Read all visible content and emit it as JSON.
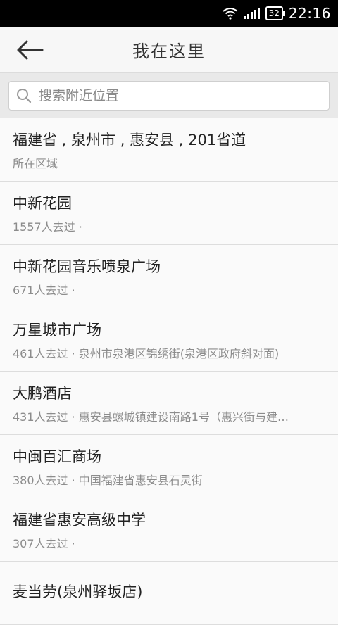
{
  "status_bar": {
    "battery": "32",
    "time": "22:16"
  },
  "header": {
    "title": "我在这里",
    "back_icon": "arrow-left-icon"
  },
  "search": {
    "placeholder": "搜索附近位置",
    "icon": "search-icon"
  },
  "locations": [
    {
      "name": "福建省 , 泉州市 , 惠安县 , 201省道",
      "sub": "所在区域"
    },
    {
      "name": "中新花园",
      "sub": "1557人去过 ·"
    },
    {
      "name": "中新花园音乐喷泉广场",
      "sub": "671人去过 ·"
    },
    {
      "name": "万星城市广场",
      "sub": "461人去过 · 泉州市泉港区锦绣街(泉港区政府斜对面)"
    },
    {
      "name": "大鹏酒店",
      "sub": "431人去过 · 惠安县螺城镇建设南路1号（惠兴街与建…"
    },
    {
      "name": "中闽百汇商场",
      "sub": "380人去过 · 中国福建省惠安县石灵街"
    },
    {
      "name": "福建省惠安高级中学",
      "sub": "307人去过 ·"
    },
    {
      "name": "麦当劳(泉州驿坂店)",
      "sub": ""
    }
  ]
}
